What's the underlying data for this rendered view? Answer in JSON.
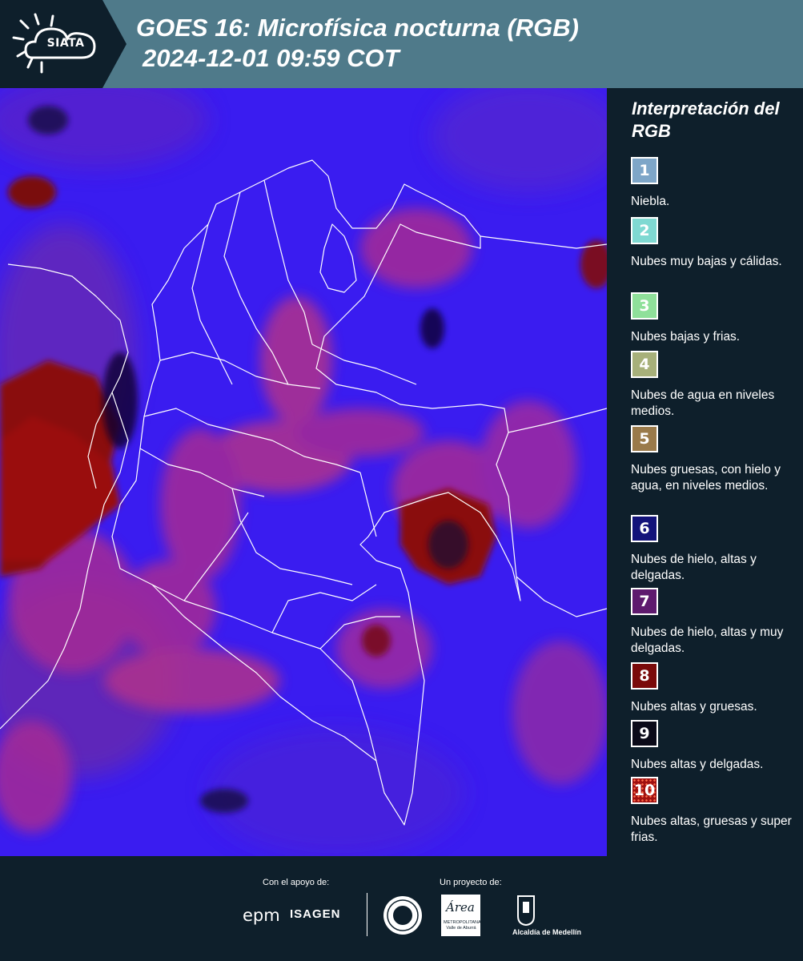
{
  "header": {
    "logo_text": "SIATA",
    "title_line1": "GOES 16: Microfísica nocturna (RGB)",
    "title_line2": "2024-12-01 09:59 COT"
  },
  "legend": {
    "title": "Interpretación del RGB",
    "items": [
      {
        "number": "1",
        "label": "Niebla.",
        "color": "#7ea6c8"
      },
      {
        "number": "2",
        "label": "Nubes muy bajas y cálidas.",
        "color": "#7fd9d2"
      },
      {
        "number": "3",
        "label": "Nubes bajas y frias.",
        "color": "#8fe09a"
      },
      {
        "number": "4",
        "label": "Nubes de agua en niveles medios.",
        "color": "#a7b07a"
      },
      {
        "number": "5",
        "label": "Nubes gruesas, con hielo y agua, en niveles medios.",
        "color": "#9a7a4a"
      },
      {
        "number": "6",
        "label": "Nubes de hielo, altas y delgadas.",
        "color": "#13137a"
      },
      {
        "number": "7",
        "label": "Nubes de hielo, altas y muy delgadas.",
        "color": "#5e1a6e"
      },
      {
        "number": "8",
        "label": "Nubes altas y gruesas.",
        "color": "#7a0a0a"
      },
      {
        "number": "9",
        "label": "Nubes altas y delgadas.",
        "color": "#0a0a18"
      },
      {
        "number": "10",
        "label": "Nubes altas, gruesas y super frias.",
        "color": "#a01010"
      }
    ]
  },
  "footer": {
    "support_label": "Con el apoyo de:",
    "project_label": "Un proyecto de:",
    "epm": "epm",
    "isagen": "ISAGEN",
    "area_word": "Área",
    "area_sub": "METROPOLITANA Valle de Aburrá",
    "alcaldia": "Alcaldía de Medellín"
  },
  "map": {
    "colors": {
      "base": "#3a1cf0",
      "magenta": "#b0308c",
      "red": "#8a0a0a",
      "dark": "#0b0630",
      "border": "#ffffff"
    }
  }
}
